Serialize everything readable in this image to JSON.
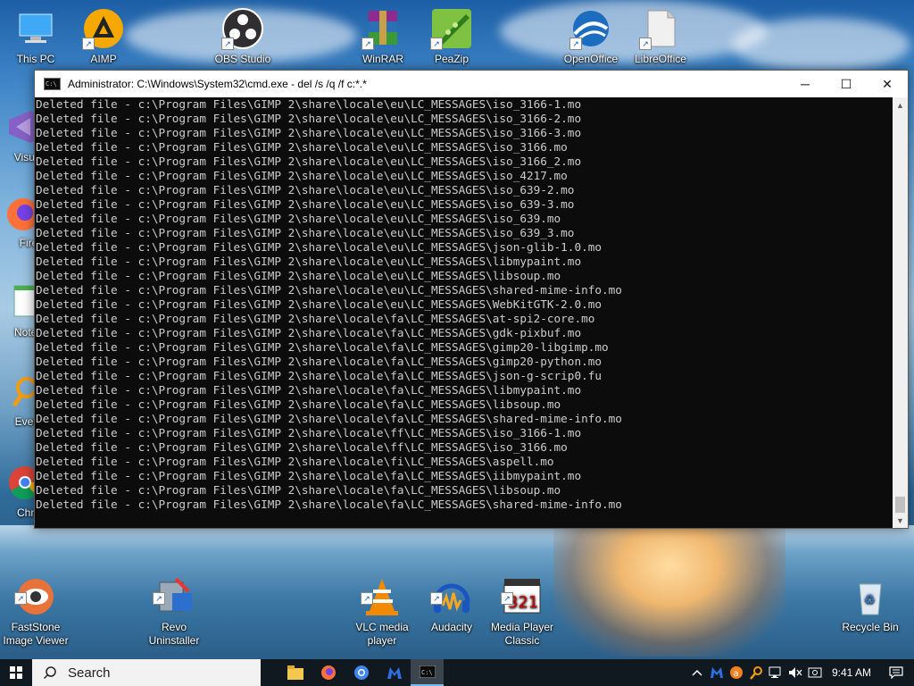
{
  "desktop": {
    "top_icons": [
      {
        "label": "This PC"
      },
      {
        "label": "AIMP"
      },
      {
        "label": "OBS Studio"
      },
      {
        "label": "WinRAR"
      },
      {
        "label": "PeaZip"
      },
      {
        "label": "OpenOffice"
      },
      {
        "label": "LibreOffice"
      }
    ],
    "left_icons": [
      {
        "label": "Visual"
      },
      {
        "label": "Fire"
      },
      {
        "label": "Notep"
      },
      {
        "label": "Every"
      },
      {
        "label": "Chro"
      }
    ],
    "bottom_icons": [
      {
        "label": "FastStone\nImage Viewer"
      },
      {
        "label": "Revo\nUninstaller"
      },
      {
        "label": "VLC media\nplayer"
      },
      {
        "label": "Audacity"
      },
      {
        "label": "Media Player\nClassic"
      },
      {
        "label": "Recycle Bin"
      }
    ]
  },
  "window": {
    "title": "Administrator: C:\\Windows\\System32\\cmd.exe - del  /s /q /f c:*.*",
    "minimize": "─",
    "maximize": "☐",
    "close": "✕",
    "lines": [
      "Deleted file - c:\\Program Files\\GIMP 2\\share\\locale\\eu\\LC_MESSAGES\\iso_3166-1.mo",
      "Deleted file - c:\\Program Files\\GIMP 2\\share\\locale\\eu\\LC_MESSAGES\\iso_3166-2.mo",
      "Deleted file - c:\\Program Files\\GIMP 2\\share\\locale\\eu\\LC_MESSAGES\\iso_3166-3.mo",
      "Deleted file - c:\\Program Files\\GIMP 2\\share\\locale\\eu\\LC_MESSAGES\\iso_3166.mo",
      "Deleted file - c:\\Program Files\\GIMP 2\\share\\locale\\eu\\LC_MESSAGES\\iso_3166_2.mo",
      "Deleted file - c:\\Program Files\\GIMP 2\\share\\locale\\eu\\LC_MESSAGES\\iso_4217.mo",
      "Deleted file - c:\\Program Files\\GIMP 2\\share\\locale\\eu\\LC_MESSAGES\\iso_639-2.mo",
      "Deleted file - c:\\Program Files\\GIMP 2\\share\\locale\\eu\\LC_MESSAGES\\iso_639-3.mo",
      "Deleted file - c:\\Program Files\\GIMP 2\\share\\locale\\eu\\LC_MESSAGES\\iso_639.mo",
      "Deleted file - c:\\Program Files\\GIMP 2\\share\\locale\\eu\\LC_MESSAGES\\iso_639_3.mo",
      "Deleted file - c:\\Program Files\\GIMP 2\\share\\locale\\eu\\LC_MESSAGES\\json-glib-1.0.mo",
      "Deleted file - c:\\Program Files\\GIMP 2\\share\\locale\\eu\\LC_MESSAGES\\libmypaint.mo",
      "Deleted file - c:\\Program Files\\GIMP 2\\share\\locale\\eu\\LC_MESSAGES\\libsoup.mo",
      "Deleted file - c:\\Program Files\\GIMP 2\\share\\locale\\eu\\LC_MESSAGES\\shared-mime-info.mo",
      "Deleted file - c:\\Program Files\\GIMP 2\\share\\locale\\eu\\LC_MESSAGES\\WebKitGTK-2.0.mo",
      "Deleted file - c:\\Program Files\\GIMP 2\\share\\locale\\fa\\LC_MESSAGES\\at-spi2-core.mo",
      "Deleted file - c:\\Program Files\\GIMP 2\\share\\locale\\fa\\LC_MESSAGES\\gdk-pixbuf.mo",
      "Deleted file - c:\\Program Files\\GIMP 2\\share\\locale\\fa\\LC_MESSAGES\\gimp20-libgimp.mo",
      "Deleted file - c:\\Program Files\\GIMP 2\\share\\locale\\fa\\LC_MESSAGES\\gimp20-python.mo",
      "Deleted file - c:\\Program Files\\GIMP 2\\share\\locale\\fa\\LC_MESSAGES\\json-g-scrip0.fu",
      "Deleted file - c:\\Program Files\\GIMP 2\\share\\locale\\fa\\LC_MESSAGES\\libmypaint.mo",
      "Deleted file - c:\\Program Files\\GIMP 2\\share\\locale\\fa\\LC_MESSAGES\\libsoup.mo",
      "Deleted file - c:\\Program Files\\GIMP 2\\share\\locale\\fa\\LC_MESSAGES\\shared-mime-info.mo",
      "Deleted file - c:\\Program Files\\GIMP 2\\share\\locale\\ff\\LC_MESSAGES\\iso_3166-1.mo",
      "Deleted file - c:\\Program Files\\GIMP 2\\share\\locale\\ff\\LC_MESSAGES\\iso_3166.mo",
      "Deleted file - c:\\Program Files\\GIMP 2\\share\\locale\\fi\\LC_MESSAGES\\aspell.mo",
      "Deleted file - c:\\Program Files\\GIMP 2\\share\\locale\\fa\\LC_MESSAGES\\iibmypaint.mo",
      "Deleted file - c:\\Program Files\\GIMP 2\\share\\locale\\fa\\LC_MESSAGES\\libsoup.mo",
      "Deleted file - c:\\Program Files\\GIMP 2\\share\\locale\\fa\\LC_MESSAGES\\shared-mime-info.mo"
    ]
  },
  "taskbar": {
    "search_label": "Search",
    "apps": [
      {
        "icon": "file-explorer-icon",
        "color": "#f2c94c"
      },
      {
        "icon": "firefox-icon",
        "color": "#ff7139"
      },
      {
        "icon": "chrome-icon",
        "color": "#4285f4"
      },
      {
        "icon": "malwarebytes-icon",
        "color": "#2f6fe4"
      },
      {
        "icon": "command-prompt-icon",
        "color": "#0c0c0c"
      }
    ],
    "time": "9:41 AM"
  }
}
